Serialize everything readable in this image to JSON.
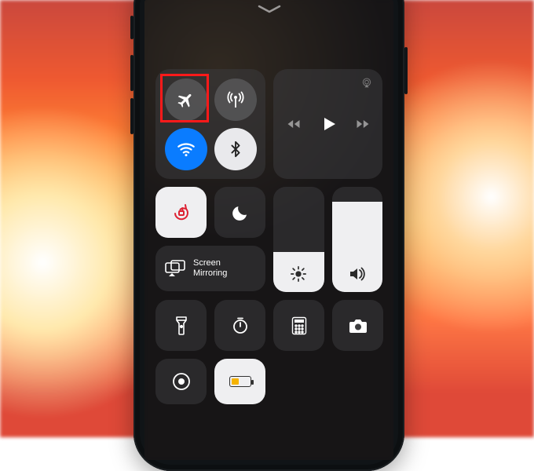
{
  "screen_mirroring": {
    "label": "Screen\nMirroring"
  },
  "toggles": {
    "airplane": {
      "on": false,
      "highlighted": true
    },
    "cellular": {
      "on": false
    },
    "wifi": {
      "on": true
    },
    "bluetooth": {
      "on": true
    }
  },
  "sliders": {
    "brightness_pct": 38,
    "volume_pct": 86
  },
  "battery": {
    "level_pct": 35,
    "low_power_mode": true
  },
  "colors": {
    "wifi_on": "#0a7cff",
    "highlight_ring": "#ff1a1a",
    "low_power_yellow": "#f6b300"
  }
}
